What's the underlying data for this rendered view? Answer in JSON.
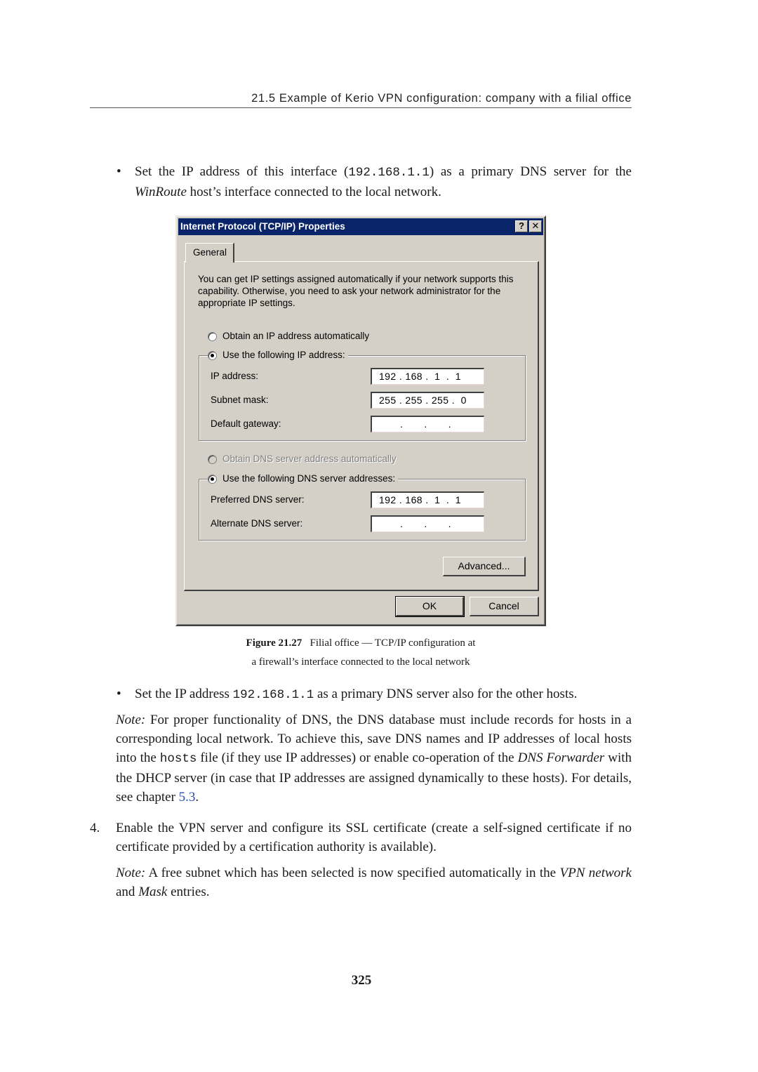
{
  "running_head": "21.5  Example of Kerio VPN configuration: company with a filial office",
  "bullet_symbol": "•",
  "para1": {
    "pre": "Set the IP address of this interface (",
    "code": "192.168.1.1",
    "post": ") as a primary DNS server for the ",
    "italic": "WinRoute",
    "end": " host’s interface connected to the local network."
  },
  "dialog": {
    "title": "Internet Protocol (TCP/IP) Properties",
    "help_button": "?",
    "close_button": "✕",
    "tab_label": "General",
    "intro_text": "You can get IP settings assigned automatically if your network supports this capability. Otherwise, you need to ask your network administrator for the appropriate IP settings.",
    "radio_obtain_ip": {
      "label": "Obtain an IP address automatically",
      "checked": false
    },
    "radio_use_ip": {
      "label": "Use the following IP address:",
      "checked": true
    },
    "ip_address": {
      "label": "IP address:",
      "value": "192 . 168 .  1  .  1"
    },
    "subnet_mask": {
      "label": "Subnet mask:",
      "value": "255 . 255 . 255 .  0"
    },
    "default_gateway": {
      "label": "Default gateway:",
      "value": "       .       .       ."
    },
    "radio_obtain_dns": {
      "label": "Obtain DNS server address automatically",
      "checked": false,
      "disabled": true
    },
    "radio_use_dns": {
      "label": "Use the following DNS server addresses:",
      "checked": true
    },
    "preferred_dns": {
      "label": "Preferred DNS server:",
      "value": "192 . 168 .  1  .  1"
    },
    "alternate_dns": {
      "label": "Alternate DNS server:",
      "value": "       .       .       ."
    },
    "advanced_button": "Advanced...",
    "ok_button": "OK",
    "cancel_button": "Cancel"
  },
  "figure_caption": {
    "label": "Figure 21.27",
    "line1": "Filial office — TCP/IP configuration at",
    "line2": "a firewall’s interface connected to the local network"
  },
  "para2": {
    "pre": "Set the IP address ",
    "code": "192.168.1.1",
    "post": " as a primary DNS server also for the other hosts."
  },
  "note1": {
    "note_label": "Note:",
    "t1": " For proper functionality of DNS, the DNS database must include records for hosts in a corresponding local network.  To achieve this, save DNS names and IP addresses of local hosts into the ",
    "code": "hosts",
    "t2": " file (if they use IP addresses) or enable co-operation of the ",
    "italic": "DNS Forwarder",
    "t3": " with the DHCP server (in case that IP addresses are assigned dynamically to these hosts). For details, see chapter ",
    "link": "5.3",
    "t4": "."
  },
  "step4": {
    "number": "4.",
    "text": "Enable the VPN server and configure its SSL certificate (create a self-signed certificate if no certificate provided by a certification authority is available)."
  },
  "note2": {
    "note_label": "Note:",
    "t1": " A free subnet which has been selected is now specified automatically in the ",
    "italic1": "VPN network",
    "t2": " and ",
    "italic2": "Mask",
    "t3": " entries."
  },
  "page_number": "325",
  "colors": {
    "titlebar": "#0a246a",
    "dialog_bg": "#d4d0c8",
    "link": "#2b4fa8"
  }
}
